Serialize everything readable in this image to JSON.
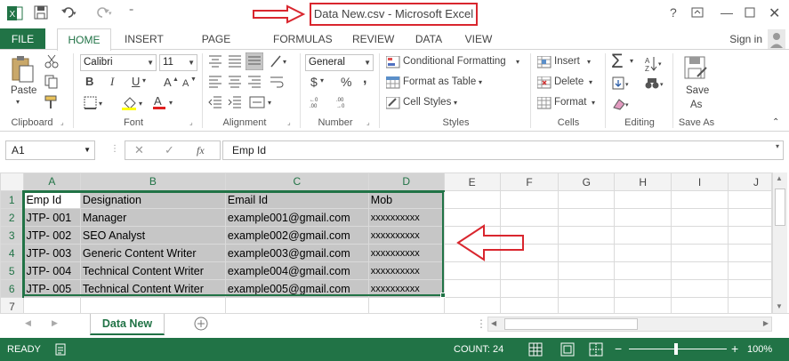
{
  "title": "Data New.csv - Microsoft Excel",
  "title_bar_help": "?",
  "tabs": [
    "FILE",
    "HOME",
    "INSERT",
    "PAGE LAYOUT",
    "FORMULAS",
    "REVIEW",
    "DATA",
    "VIEW"
  ],
  "sign_in": "Sign in",
  "ribbon": {
    "clipboard": {
      "label": "Clipboard",
      "paste": "Paste"
    },
    "font": {
      "label": "Font",
      "name": "Calibri",
      "size": "11",
      "bold": "B",
      "italic": "I",
      "underline": "U"
    },
    "alignment": {
      "label": "Alignment"
    },
    "number": {
      "label": "Number",
      "format": "General",
      "currency": "$",
      "percent": "%",
      "comma": ","
    },
    "styles": {
      "label": "Styles",
      "conditional": "Conditional Formatting",
      "format_table": "Format as Table",
      "cell_styles": "Cell Styles"
    },
    "cells": {
      "label": "Cells",
      "insert": "Insert",
      "delete": "Delete",
      "format": "Format"
    },
    "editing": {
      "label": "Editing",
      "sigma": "Σ"
    },
    "save": {
      "label": "Save As",
      "line1": "Save",
      "line2": "As"
    }
  },
  "formula_bar": {
    "name_box": "A1",
    "fx": "fx",
    "content": "Emp Id"
  },
  "grid": {
    "columns": [
      "A",
      "B",
      "C",
      "D",
      "E",
      "F",
      "G",
      "H",
      "I",
      "J"
    ],
    "rows": [
      [
        "Emp Id",
        "Designation",
        "Email Id",
        "Mob"
      ],
      [
        "JTP- 001",
        "Manager",
        "example001@gmail.com",
        "xxxxxxxxxx"
      ],
      [
        "JTP- 002",
        "SEO Analyst",
        "example002@gmail.com",
        "xxxxxxxxxx"
      ],
      [
        "JTP- 003",
        "Generic Content Writer",
        "example003@gmail.com",
        "xxxxxxxxxx"
      ],
      [
        "JTP- 004",
        "Technical Content Writer",
        "example004@gmail.com",
        "xxxxxxxxxx"
      ],
      [
        "JTP- 005",
        "Technical Content Writer",
        "example005@gmail.com",
        "xxxxxxxxxx"
      ],
      [
        "",
        "",
        "",
        ""
      ]
    ]
  },
  "sheet_tab": "Data New",
  "status": {
    "ready": "READY",
    "count": "COUNT: 24",
    "zoom": "100%"
  },
  "colors": {
    "excel_green": "#217346",
    "annotation_red": "#d9262e"
  }
}
